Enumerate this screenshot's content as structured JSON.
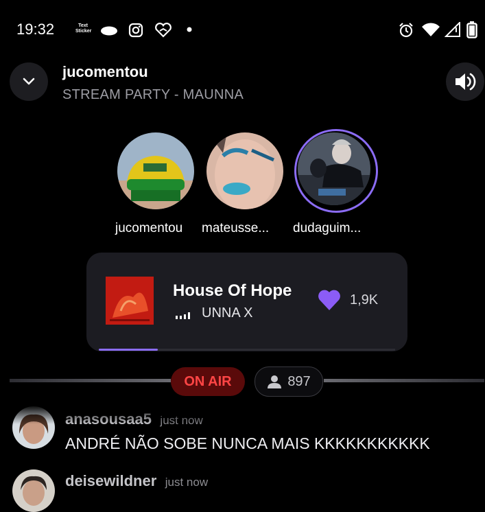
{
  "status_bar": {
    "time": "19:32",
    "notification_icons": [
      "text-sticker-icon",
      "cloud-icon",
      "instagram-icon",
      "heart-app-icon",
      "dot-icon"
    ],
    "text_sticker_label": "Text Sticker",
    "system_icons": [
      "alarm-icon",
      "wifi-icon",
      "signal-icon",
      "battery-icon"
    ]
  },
  "header": {
    "title": "jucomentou",
    "subtitle": "STREAM PARTY - MAUNNA",
    "collapse_icon": "chevron-down-icon",
    "volume_icon": "volume-icon"
  },
  "participants": [
    {
      "name": "jucomentou",
      "active": false
    },
    {
      "name": "mateusse...",
      "active": false
    },
    {
      "name": "dudaguim...",
      "active": true
    }
  ],
  "now_playing": {
    "song": "House Of Hope",
    "artist": "UNNA X",
    "likes": "1,9K",
    "progress": 0.2,
    "accent_color": "#8b6cf5"
  },
  "live": {
    "on_air_label": "ON AIR",
    "viewers": "897",
    "on_air_color": "#ff4545"
  },
  "chat": [
    {
      "user": "anasousaa5",
      "time": "just now",
      "message": "ANDRÉ NÃO SOBE NUNCA MAIS KKKKKKKKKKK"
    },
    {
      "user": "deisewildner",
      "time": "just now",
      "message": ""
    }
  ]
}
